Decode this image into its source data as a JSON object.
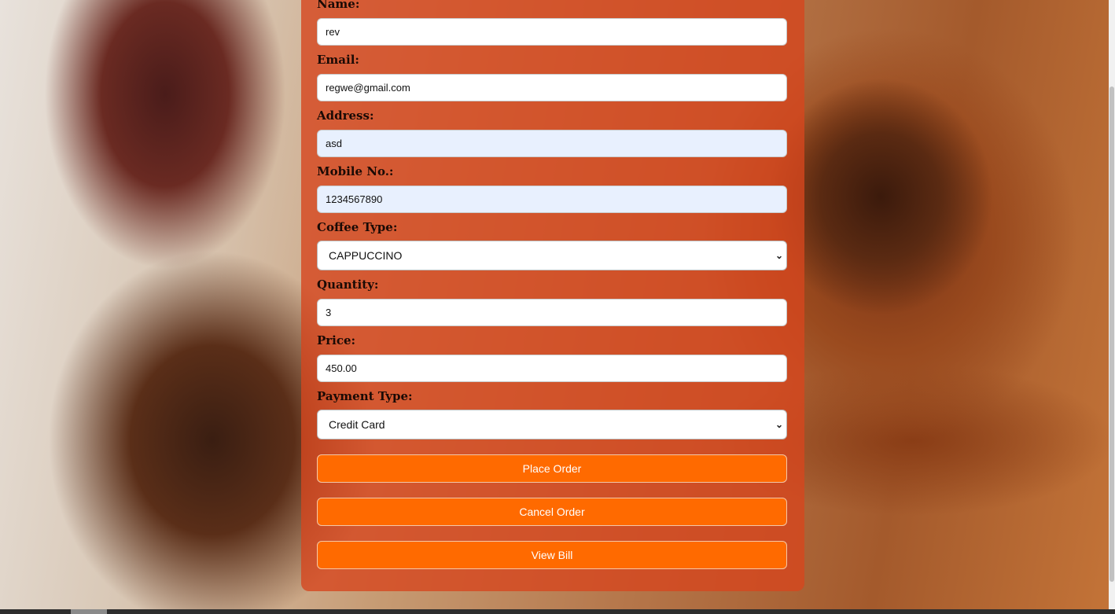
{
  "form": {
    "name": {
      "label": "Name:",
      "value": "rev"
    },
    "email": {
      "label": "Email:",
      "value": "regwe@gmail.com"
    },
    "address": {
      "label": "Address:",
      "value": "asd"
    },
    "mobile": {
      "label": "Mobile No.:",
      "value": "1234567890"
    },
    "coffee_type": {
      "label": "Coffee Type:",
      "selected": "CAPPUCCINO"
    },
    "quantity": {
      "label": "Quantity:",
      "value": "3"
    },
    "price": {
      "label": "Price:",
      "value": "450.00"
    },
    "payment_type": {
      "label": "Payment Type:",
      "selected": "Credit Card"
    }
  },
  "buttons": {
    "place_order": "Place Order",
    "cancel_order": "Cancel Order",
    "view_bill": "View Bill"
  },
  "icons": {
    "select_chevron": "chevron-down-icon"
  },
  "colors": {
    "button": "#ff6a00",
    "panel": "#d6461e",
    "autofill": "#e8f0fe"
  }
}
